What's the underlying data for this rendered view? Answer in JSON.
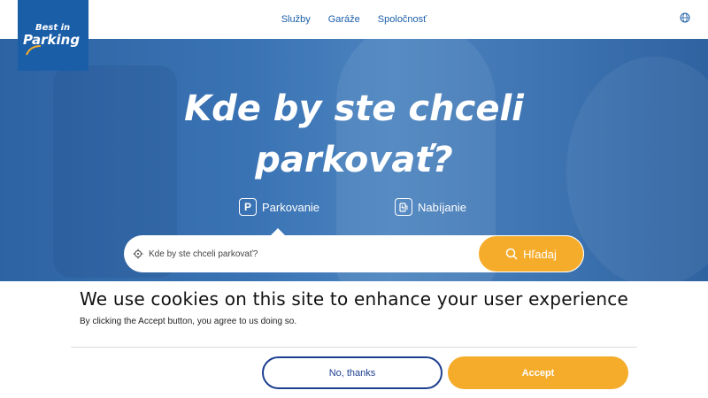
{
  "brand": {
    "logo_top": "Best in",
    "logo_bottom": "Parking",
    "color": "#1b5ea8"
  },
  "nav": {
    "items": [
      "Služby",
      "Garáže",
      "Spoločnosť"
    ],
    "globe_icon": "globe-icon"
  },
  "hero": {
    "headline_line1": "Kde by ste chceli",
    "headline_line2": "parkovať?",
    "tabs": [
      {
        "label": "Parkovanie",
        "icon": "parking-icon",
        "icon_glyph": "P"
      },
      {
        "label": "Nabíjanie",
        "icon": "charging-icon"
      }
    ]
  },
  "search": {
    "placeholder": "Kde by ste chceli parkovať?",
    "button_label": "Hľadaj",
    "accent": "#f5ac2b"
  },
  "cookie": {
    "title": "We use cookies on this site to enhance your user experience",
    "text": "By clicking the Accept button, you agree to us doing so.",
    "decline_label": "No, thanks",
    "accept_label": "Accept",
    "decline_color": "#1d3f8f",
    "accept_color": "#f5ac2b"
  }
}
